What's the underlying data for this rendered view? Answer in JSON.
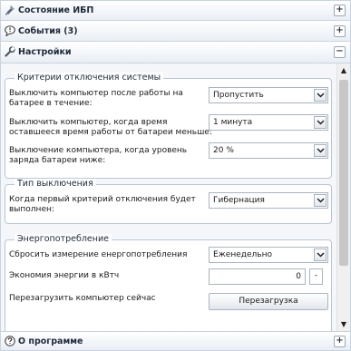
{
  "sections": {
    "ups_status": {
      "title": "Состояние ИБП",
      "toggle": "+"
    },
    "events": {
      "title": "События (3)",
      "toggle": "+"
    },
    "settings": {
      "title": "Настройки",
      "toggle": "−"
    },
    "about": {
      "title": "О программе",
      "toggle": "+"
    }
  },
  "shutdown_criteria": {
    "legend": "Критерии отключения системы",
    "after_battery": {
      "label_line1": "Выключить компьютер после работы на",
      "label_line2": "батарее в течение:",
      "value": "Пропустить"
    },
    "time_left": {
      "label_line1": "Выключить компьютер, когда время",
      "label_line2": "оставшееся время работы от батареи меньше:",
      "value": "1 минута"
    },
    "charge_level": {
      "label_line1": "Выключение компьютера, когда уровень",
      "label_line2": "заряда батареи ниже:",
      "value": "20 %"
    }
  },
  "shutdown_type": {
    "legend": "Тип выключения",
    "first_criterion": {
      "label_line1": "Когда первый критерий отключения будет",
      "label_line2": "выполнен:",
      "value": "Гибернация"
    }
  },
  "energy": {
    "legend": "Энергопотребление",
    "reset": {
      "label": "Сбросить измерение енергопотребления",
      "value": "Еженедельно"
    },
    "savings": {
      "label": "Экономия энергии в кВтч",
      "value": "0",
      "unit": "-"
    },
    "restart": {
      "label": "Перезагрузить компьютер сейчас",
      "button": "Перезагрузка"
    }
  }
}
